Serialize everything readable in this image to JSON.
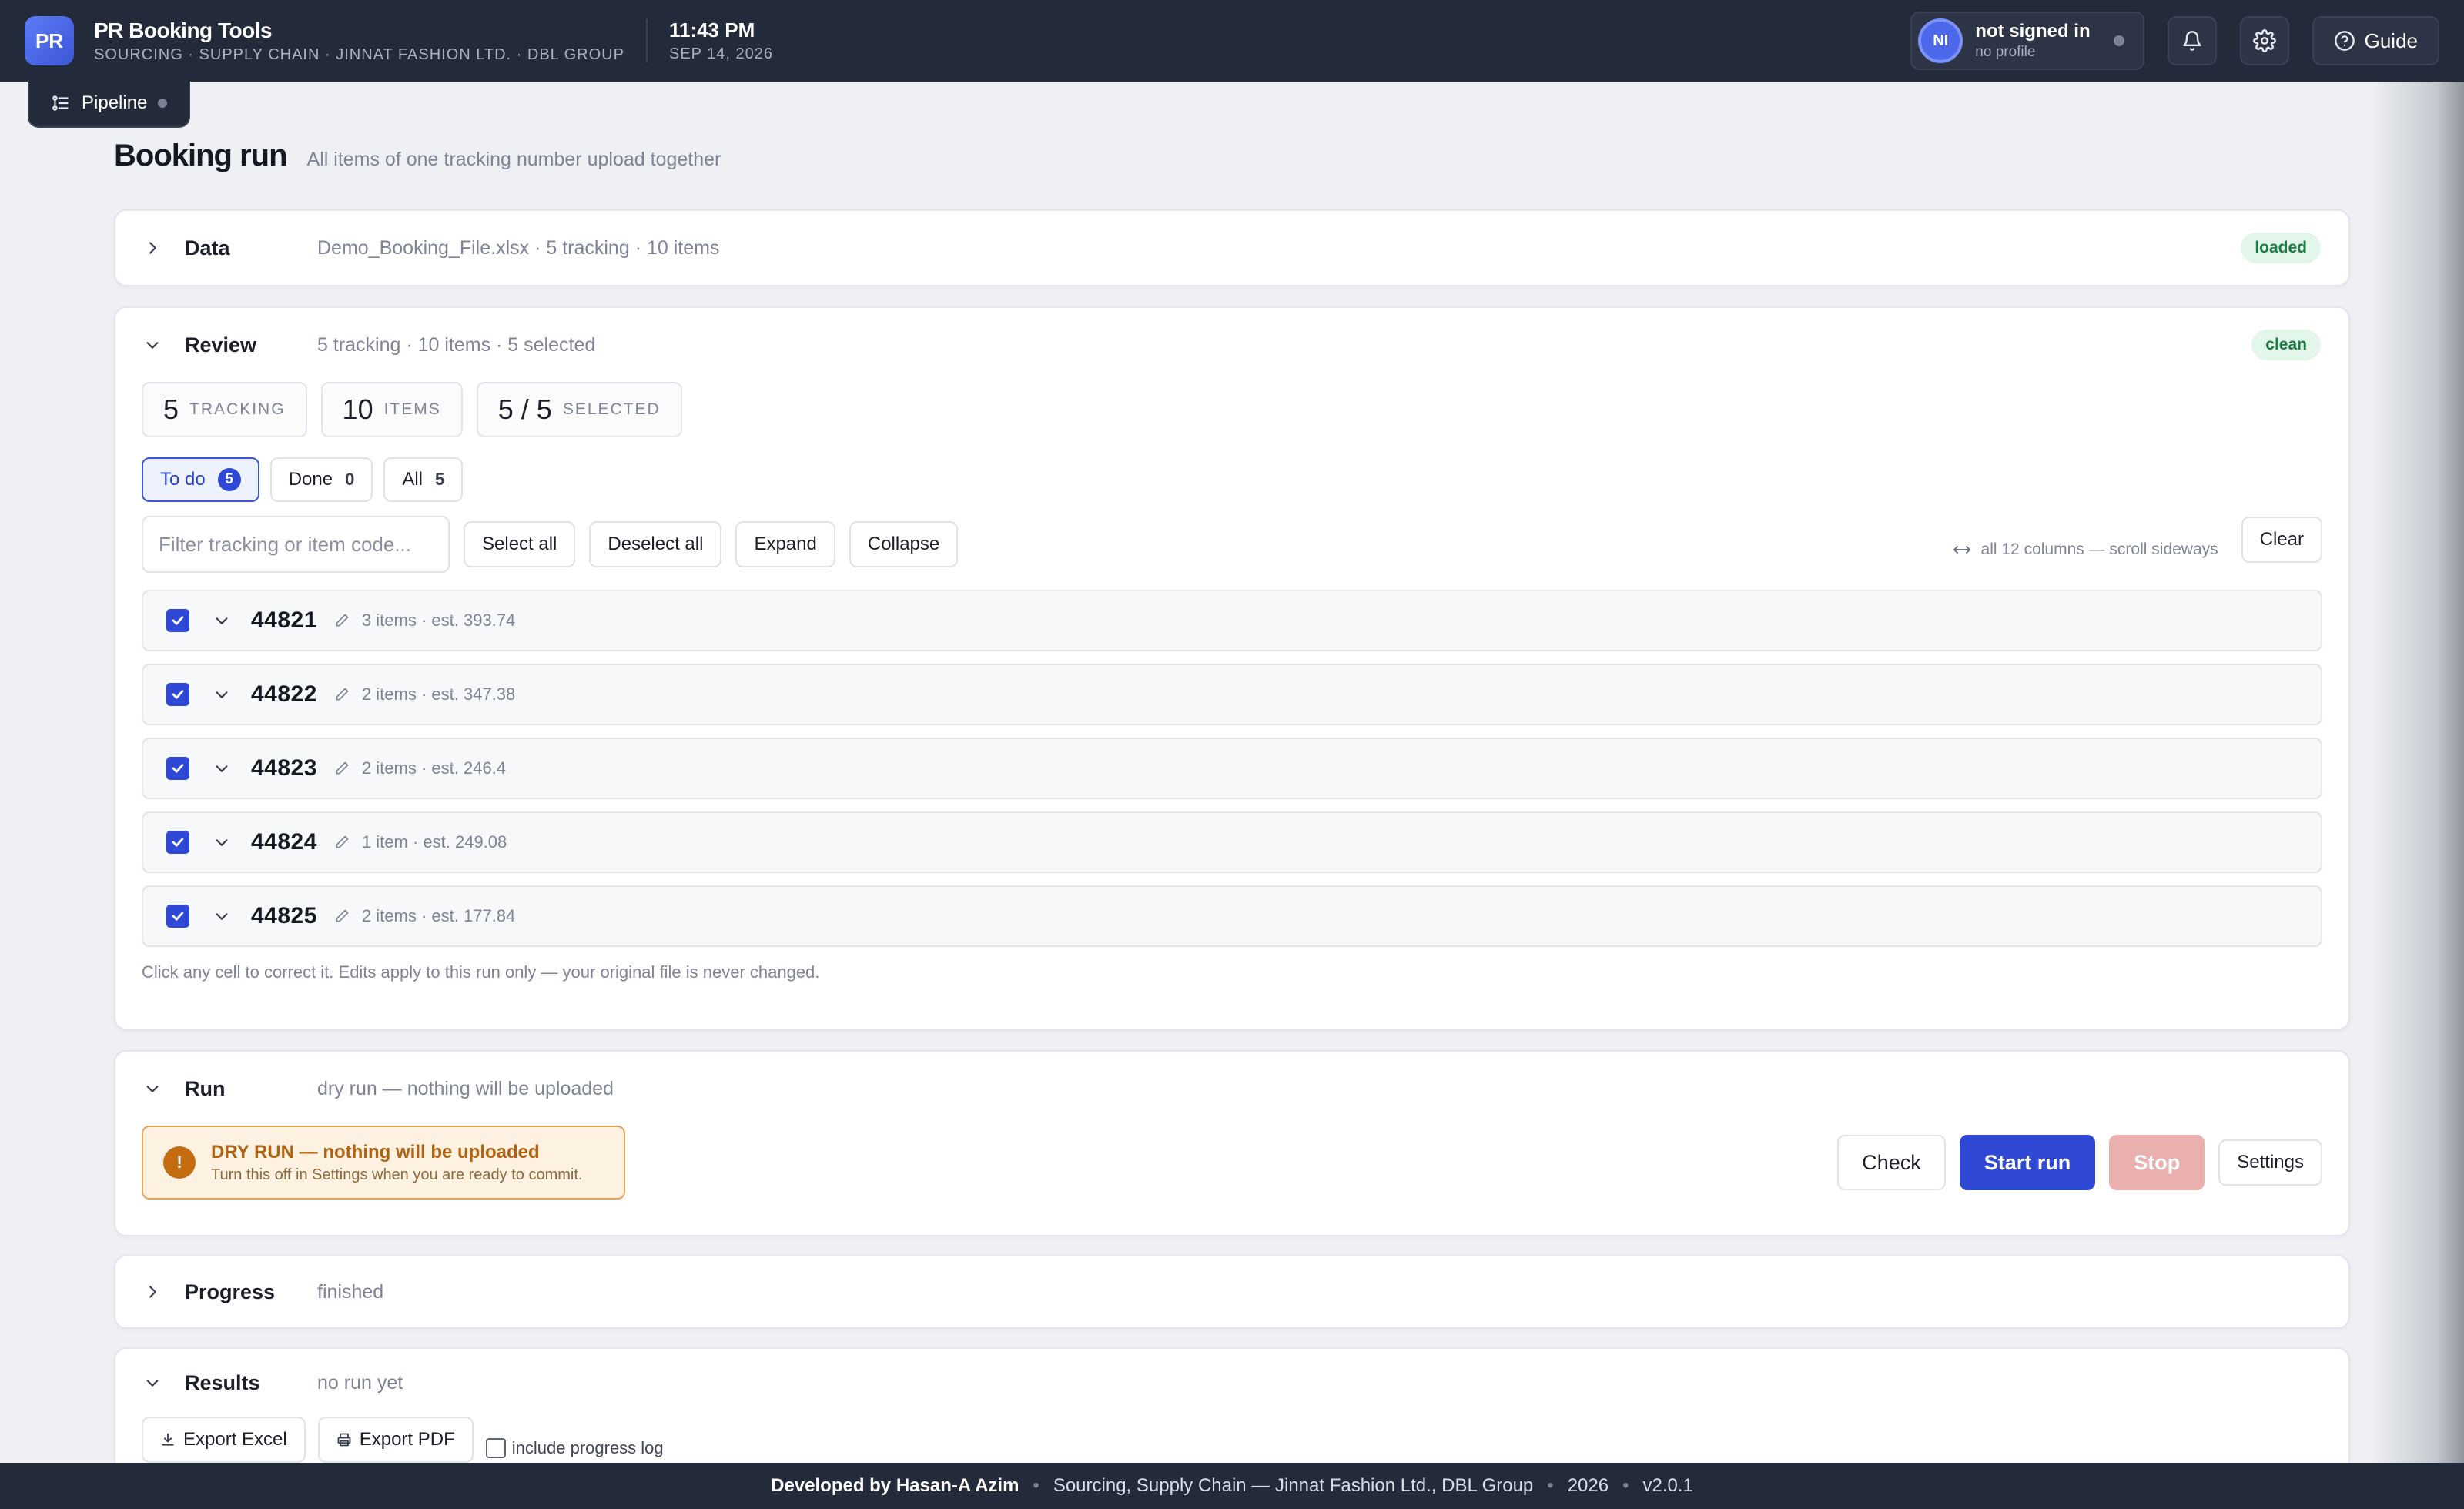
{
  "app": {
    "logo": "PR",
    "title": "PR Booking Tools",
    "subtitle": "SOURCING · SUPPLY CHAIN · JINNAT FASHION LTD. · DBL GROUP",
    "time": "11:43 PM",
    "date": "SEP 14, 2026"
  },
  "profile": {
    "initials": "NI",
    "name": "not signed in",
    "sub": "no profile"
  },
  "header_buttons": {
    "guide": "Guide"
  },
  "pipeline_tab": "Pipeline",
  "page": {
    "title": "Booking run",
    "subtitle": "All items of one tracking number upload together"
  },
  "data_card": {
    "title": "Data",
    "meta": "Demo_Booking_File.xlsx · 5 tracking · 10 items",
    "badge": "loaded"
  },
  "review_card": {
    "title": "Review",
    "meta": "5 tracking · 10 items · 5 selected",
    "badge": "clean",
    "stats": [
      {
        "num": "5",
        "label": "TRACKING"
      },
      {
        "num": "10",
        "label": "ITEMS"
      },
      {
        "num": "5 / 5",
        "label": "SELECTED"
      }
    ],
    "filter_tabs": [
      {
        "label": "To do",
        "count": "5"
      },
      {
        "label": "Done",
        "count": "0"
      },
      {
        "label": "All",
        "count": "5"
      }
    ],
    "search_placeholder": "Filter tracking or item code...",
    "buttons": {
      "select_all": "Select all",
      "deselect_all": "Deselect all",
      "expand": "Expand",
      "collapse": "Collapse",
      "clear": "Clear"
    },
    "scroll_hint": "all 12 columns — scroll sideways",
    "rows": [
      {
        "tracking": "44821",
        "meta": "3 items · est. 393.74"
      },
      {
        "tracking": "44822",
        "meta": "2 items · est. 347.38"
      },
      {
        "tracking": "44823",
        "meta": "2 items · est. 246.4"
      },
      {
        "tracking": "44824",
        "meta": "1 item · est. 249.08"
      },
      {
        "tracking": "44825",
        "meta": "2 items · est. 177.84"
      }
    ],
    "footnote": "Click any cell to correct it. Edits apply to this run only — your original file is never changed."
  },
  "run_card": {
    "title": "Run",
    "meta": "dry run — nothing will be uploaded",
    "dry_title": "DRY RUN — nothing will be uploaded",
    "dry_sub": "Turn this off in Settings when you are ready to commit.",
    "buttons": {
      "check": "Check",
      "start": "Start run",
      "stop": "Stop",
      "settings": "Settings"
    }
  },
  "progress_card": {
    "title": "Progress",
    "meta": "finished"
  },
  "results_card": {
    "title": "Results",
    "meta": "no run yet",
    "export_excel": "Export Excel",
    "export_pdf": "Export PDF",
    "include_log": "include progress log"
  },
  "footer": {
    "developer": "Developed by Hasan-A Azim",
    "org": "Sourcing, Supply Chain — Jinnat Fashion Ltd., DBL Group",
    "year": "2026",
    "version": "v2.0.1"
  },
  "colors": {
    "topbar": "#232a39",
    "accent": "#2f49d6",
    "success_bg": "#e3f6ea",
    "warning_bg": "#fdf2e2",
    "warning_text": "#b06210"
  }
}
